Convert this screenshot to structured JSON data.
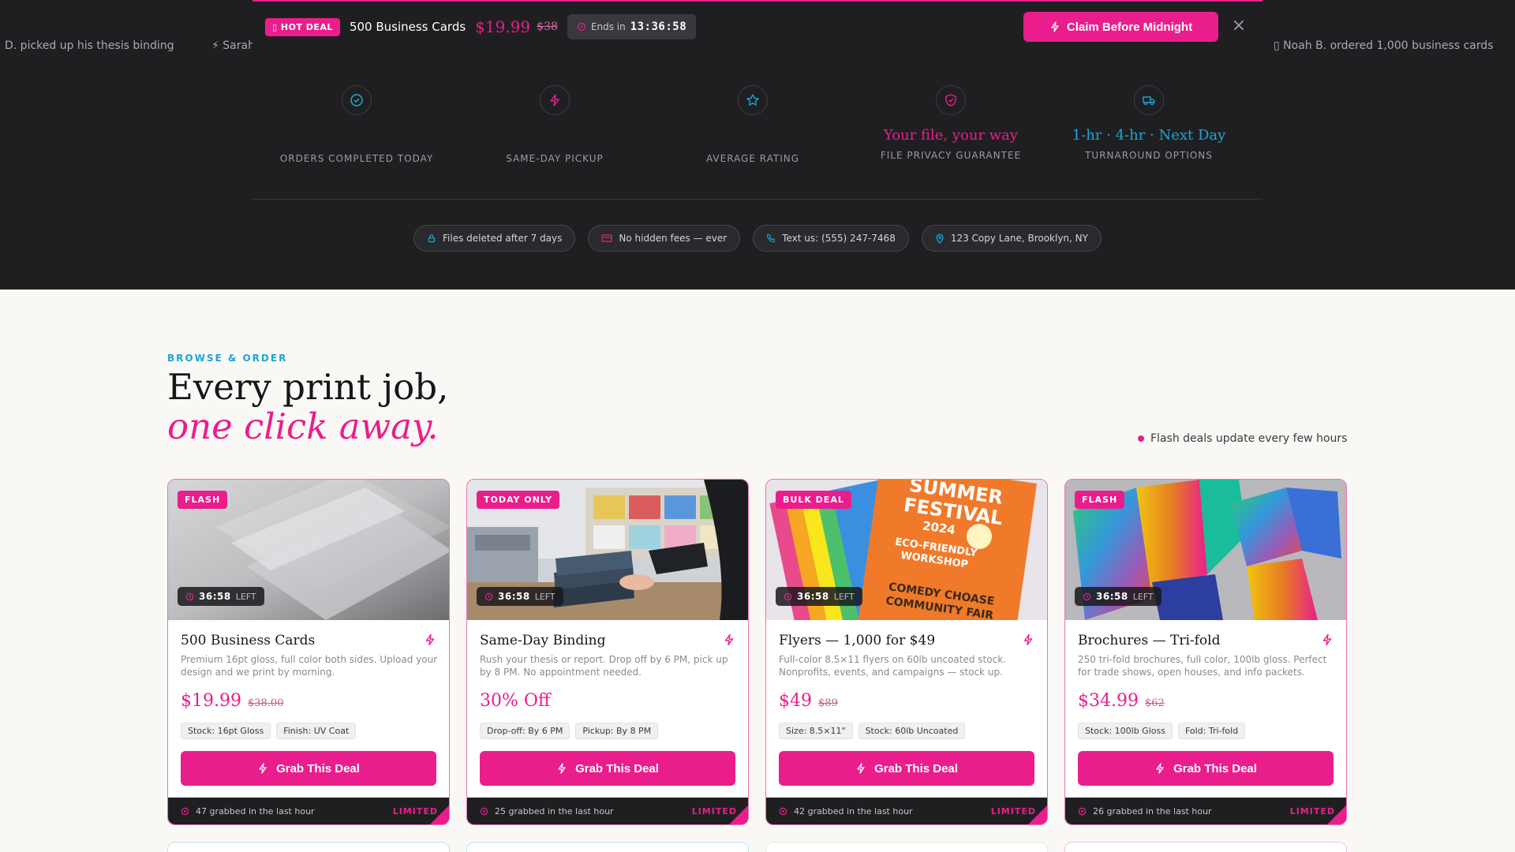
{
  "ticker": {
    "left": "D. picked up his thesis binding",
    "left2": "⚡ Sarah",
    "right": "▯ Noah B. ordered 1,000 business cards"
  },
  "deal_bar": {
    "badge": "▯ HOT DEAL",
    "product": "500 Business Cards",
    "price": "$19.99",
    "old_price": "$38",
    "ends_label": "Ends in",
    "countdown": "13:36:58",
    "claim_label": "Claim Before Midnight"
  },
  "stats": [
    {
      "icon": "check-circle-icon",
      "value": "",
      "label": "ORDERS COMPLETED TODAY"
    },
    {
      "icon": "bolt-icon",
      "value": "",
      "label": "SAME-DAY PICKUP"
    },
    {
      "icon": "star-icon",
      "value": "",
      "label": "AVERAGE RATING"
    },
    {
      "icon": "shield-icon",
      "value": "Your file, your way",
      "label": "FILE PRIVACY GUARANTEE"
    },
    {
      "icon": "truck-icon",
      "value": "1-hr · 4-hr · Next Day",
      "label": "TURNAROUND OPTIONS"
    }
  ],
  "pills": [
    {
      "icon": "lock-icon",
      "label": "Files deleted after 7 days"
    },
    {
      "icon": "card-icon",
      "label": "No hidden fees — ever"
    },
    {
      "icon": "phone-icon",
      "label": "Text us: (555) 247-7468"
    },
    {
      "icon": "pin-icon",
      "label": "123 Copy Lane, Brooklyn, NY"
    }
  ],
  "section": {
    "eyebrow": "BROWSE & ORDER",
    "title_line1": "Every print job,",
    "title_line2": "one click away.",
    "note": "Flash deals update every few hours"
  },
  "cards": [
    {
      "badge": "FLASH",
      "timer": "36:58",
      "timer_suffix": "LEFT",
      "title": "500 Business Cards",
      "desc": "Premium 16pt gloss, full color both sides. Upload your design and we print by morning.",
      "price": "$19.99",
      "old_price": "$38.00",
      "tags": [
        "Stock: 16pt Gloss",
        "Finish: UV Coat"
      ],
      "cta": "Grab This Deal",
      "grabbed": "47 grabbed in the last hour",
      "limited": "LIMITED"
    },
    {
      "badge": "TODAY ONLY",
      "timer": "36:58",
      "timer_suffix": "LEFT",
      "title": "Same-Day Binding",
      "desc": "Rush your thesis or report. Drop off by 6 PM, pick up by 8 PM. No appointment needed.",
      "price": "30% Off",
      "old_price": "",
      "tags": [
        "Drop-off: By 6 PM",
        "Pickup: By 8 PM"
      ],
      "cta": "Grab This Deal",
      "grabbed": "25 grabbed in the last hour",
      "limited": "LIMITED"
    },
    {
      "badge": "BULK DEAL",
      "timer": "36:58",
      "timer_suffix": "LEFT",
      "title": "Flyers — 1,000 for $49",
      "desc": "Full-color 8.5×11 flyers on 60lb uncoated stock. Nonprofits, events, and campaigns — stock up.",
      "price": "$49",
      "old_price": "$89",
      "tags": [
        "Size: 8.5×11\"",
        "Stock: 60lb Uncoated"
      ],
      "cta": "Grab This Deal",
      "grabbed": "42 grabbed in the last hour",
      "limited": "LIMITED",
      "poster": {
        "line1": "SUMMER",
        "line2": "FESTIVAL",
        "line3": "2024",
        "line4": "ECO-FRIENDLY",
        "line5": "WORKSHOP",
        "line6": "COMEDY CHOASE",
        "line7": "COMMUNITY FAIR"
      }
    },
    {
      "badge": "FLASH",
      "timer": "36:58",
      "timer_suffix": "LEFT",
      "title": "Brochures — Tri-fold",
      "desc": "250 tri-fold brochures, full color, 100lb gloss. Perfect for trade shows, open houses, and info packets.",
      "price": "$34.99",
      "old_price": "$62",
      "tags": [
        "Stock: 100lb Gloss",
        "Fold: Tri-fold"
      ],
      "cta": "Grab This Deal",
      "grabbed": "26 grabbed in the last hour",
      "limited": "LIMITED"
    }
  ],
  "colors": {
    "accent": "#e91e8c",
    "info": "#1aa6d6",
    "dark": "#1f1f22"
  }
}
